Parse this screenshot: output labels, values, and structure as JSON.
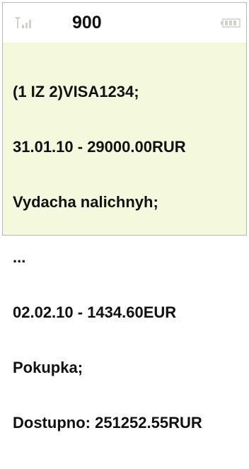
{
  "header": {
    "sender": "900",
    "signal_icon": "signal-strength-icon",
    "battery_icon": "battery-icon"
  },
  "message": {
    "lines": [
      "(1 IZ 2)VISA1234;",
      "31.01.10 - 29000.00RUR",
      "Vydacha nalichnyh;",
      "...",
      "02.02.10 - 1434.60EUR",
      "Pokupka;",
      "Dostupno: 251252.55RUR"
    ]
  },
  "colors": {
    "message_background": "#f4f8dc",
    "header_background": "#ffffff",
    "text": "#111111"
  }
}
